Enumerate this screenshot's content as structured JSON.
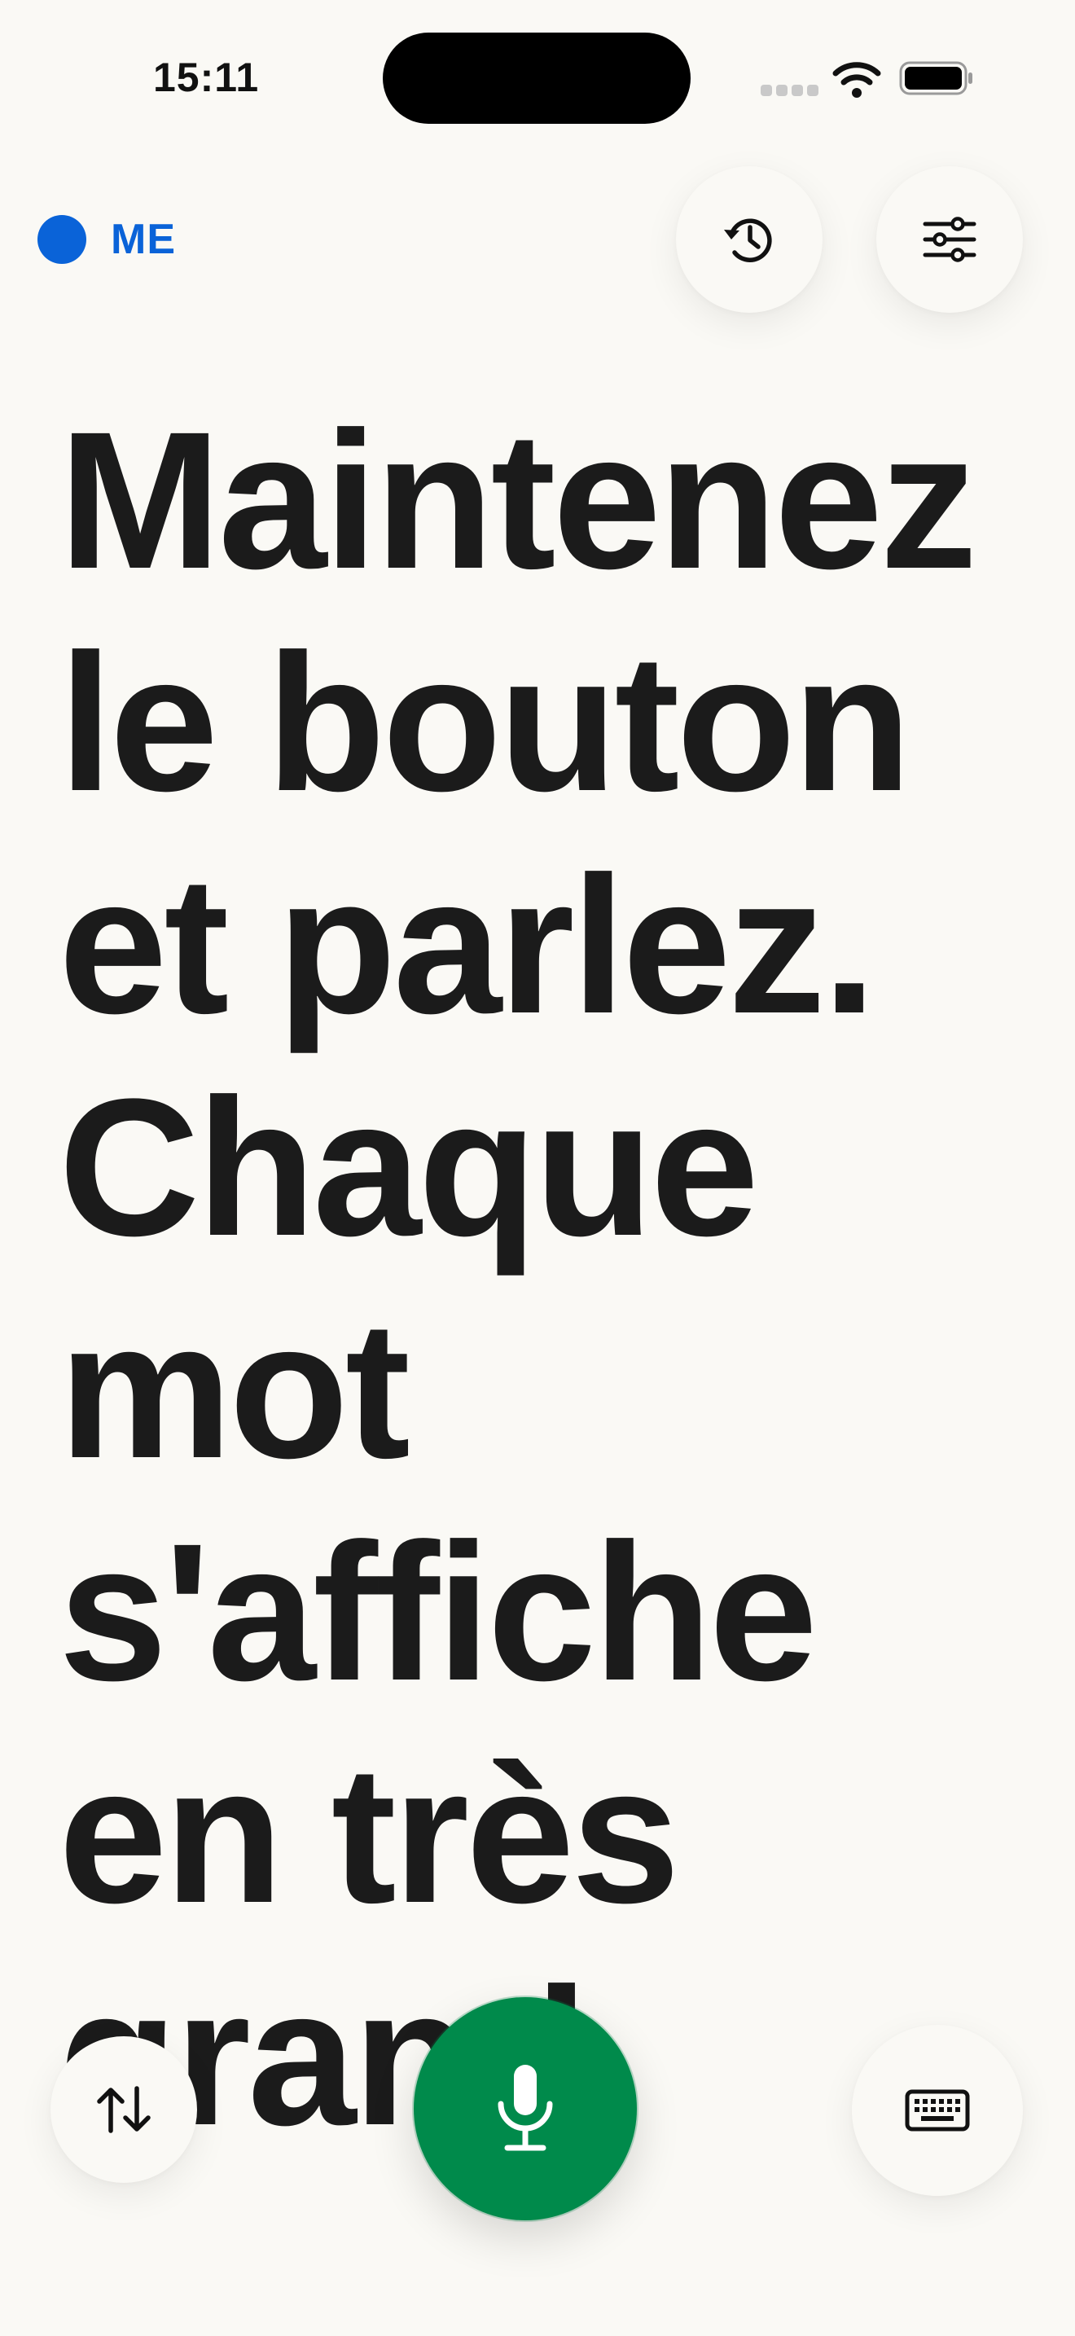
{
  "status_bar": {
    "time": "15:11",
    "icons": [
      "cellular-dots-icon",
      "wifi-icon",
      "battery-icon"
    ]
  },
  "language": {
    "code": "ME",
    "accent_color": "#0A63D8"
  },
  "toolbar": {
    "history_icon": "history-icon",
    "settings_icon": "sliders-icon"
  },
  "prompt": {
    "text": "Maintenez le bouton et parlez. Chaque mot s'affiche en très grand."
  },
  "controls": {
    "swap_icon": "swap-arrows-icon",
    "mic_icon": "microphone-icon",
    "mic_color": "#008A4B",
    "keyboard_icon": "keyboard-icon"
  },
  "colors": {
    "background": "#FAF9F5",
    "text": "#1B1B1B"
  }
}
